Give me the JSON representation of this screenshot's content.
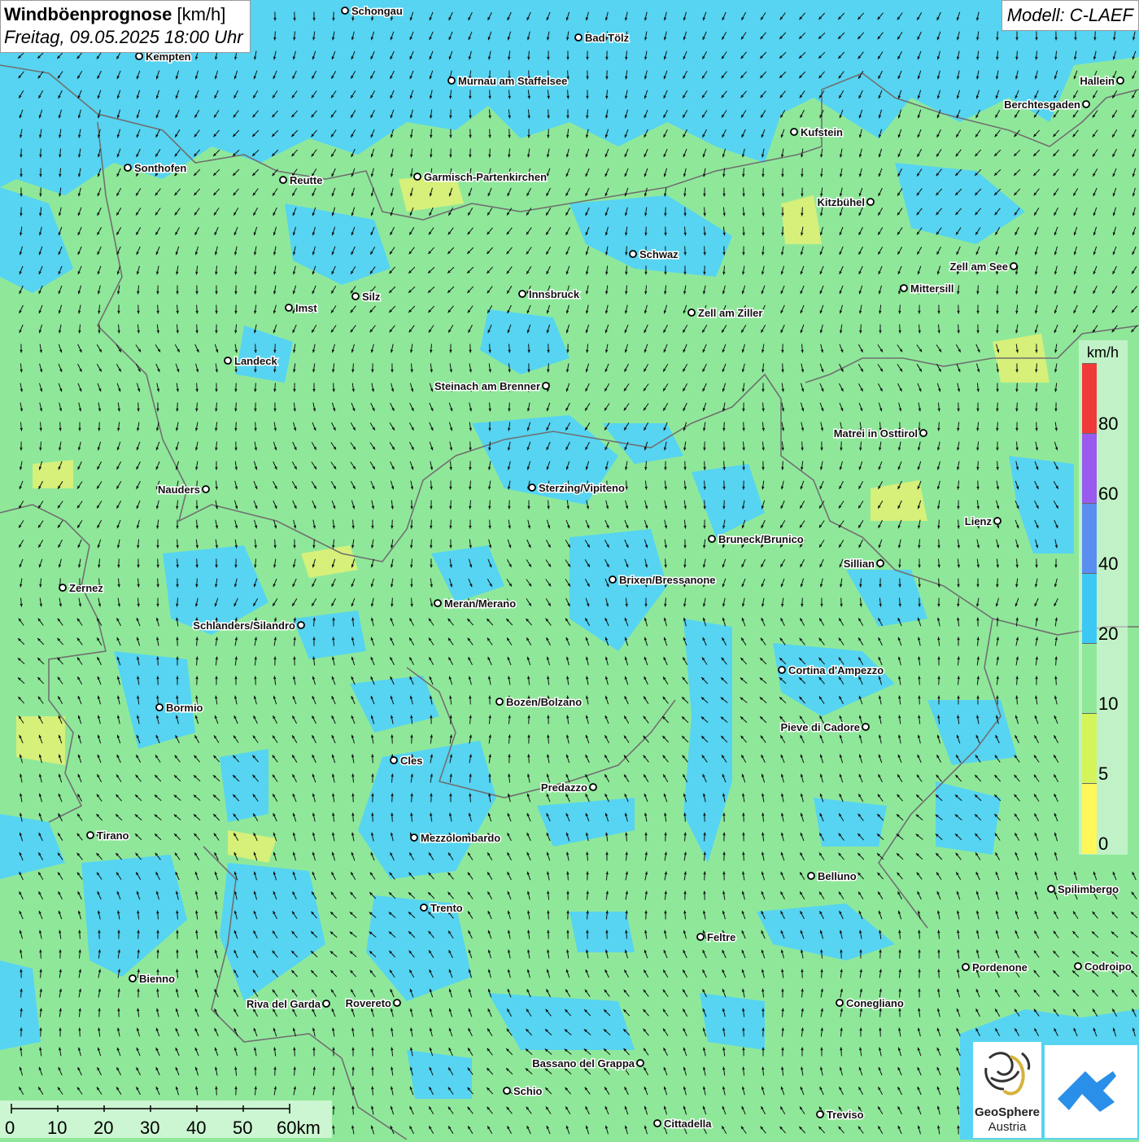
{
  "title": {
    "main_bold": "Windböenprognose",
    "main_unit": " [km/h]",
    "subtitle": "Freitag, 09.05.2025 18:00 Uhr"
  },
  "model_label": "Modell: C-LAEF",
  "legend": {
    "unit": "km/h",
    "bins": [
      {
        "label": "0",
        "color": "#fff75a"
      },
      {
        "label": "5",
        "color": "#d4f55a"
      },
      {
        "label": "10",
        "color": "#8fe89a"
      },
      {
        "label": "20",
        "color": "#3cc8f4"
      },
      {
        "label": "40",
        "color": "#5a8ef0"
      },
      {
        "label": "60",
        "color": "#9a5af0"
      },
      {
        "label": "80",
        "color": "#f03a3a"
      }
    ]
  },
  "scale_bar": {
    "labels": [
      "0",
      "10",
      "20",
      "30",
      "40",
      "50",
      "60km"
    ]
  },
  "colors": {
    "gust_low": "#8fe89a",
    "gust_mid": "#56d4f2",
    "gust_weak": "#d6f07a",
    "border": "#707070",
    "arrow": "#111111"
  },
  "cities": [
    {
      "name": "Schongau"
    },
    {
      "name": "Bad Tölz"
    },
    {
      "name": "Kempten"
    },
    {
      "name": "Murnau am Staffelsee"
    },
    {
      "name": "Hallein"
    },
    {
      "name": "Berchtesgaden"
    },
    {
      "name": "Kufstein"
    },
    {
      "name": "Sonthofen"
    },
    {
      "name": "Reutte"
    },
    {
      "name": "Garmisch-Partenkirchen"
    },
    {
      "name": "Kitzbühel"
    },
    {
      "name": "Schwaz"
    },
    {
      "name": "Zell am See"
    },
    {
      "name": "Mittersill"
    },
    {
      "name": "Innsbruck"
    },
    {
      "name": "Silz"
    },
    {
      "name": "Imst"
    },
    {
      "name": "Zell am Ziller"
    },
    {
      "name": "Landeck"
    },
    {
      "name": "Steinach am Brenner"
    },
    {
      "name": "Matrei in Osttirol"
    },
    {
      "name": "Nauders"
    },
    {
      "name": "Sterzing/Vipiteno"
    },
    {
      "name": "Lienz"
    },
    {
      "name": "Bruneck/Brunico"
    },
    {
      "name": "Sillian"
    },
    {
      "name": "Brixen/Bressanone"
    },
    {
      "name": "Zernez"
    },
    {
      "name": "Meran/Merano"
    },
    {
      "name": "Schlanders/Silandro"
    },
    {
      "name": "Cortina d'Ampezzo"
    },
    {
      "name": "Bozen/Bolzano"
    },
    {
      "name": "Bormio"
    },
    {
      "name": "Pieve di Cadore"
    },
    {
      "name": "Cles"
    },
    {
      "name": "Predazzo"
    },
    {
      "name": "Tirano"
    },
    {
      "name": "Mezzolombardo"
    },
    {
      "name": "Belluno"
    },
    {
      "name": "Spilimbergo"
    },
    {
      "name": "Trento"
    },
    {
      "name": "Feltre"
    },
    {
      "name": "Pordenone"
    },
    {
      "name": "Codroipo"
    },
    {
      "name": "Bienno"
    },
    {
      "name": "Riva del Garda"
    },
    {
      "name": "Rovereto"
    },
    {
      "name": "Conegliano"
    },
    {
      "name": "Bassano del Grappa"
    },
    {
      "name": "Schio"
    },
    {
      "name": "Treviso"
    },
    {
      "name": "Cittadella"
    }
  ],
  "logos": {
    "geosphere_line1": "GeoSphere",
    "geosphere_line2": "Austria"
  }
}
